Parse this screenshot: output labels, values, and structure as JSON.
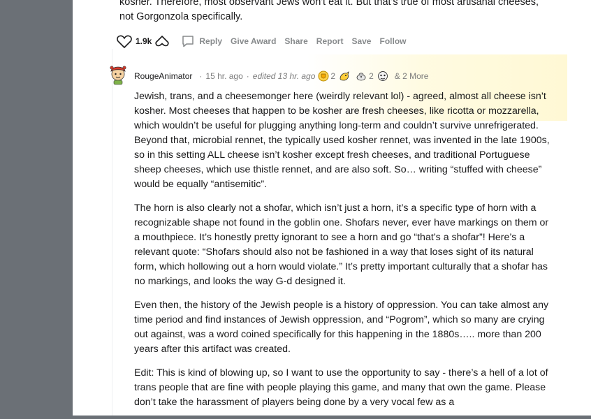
{
  "previous_comment": {
    "text_lines": [
      "kosher. Therefore, most observant Jews won't eat it. But that's true of most artisanal cheeses,",
      "not Gorgonzola specifically."
    ],
    "vote_count": "1.9k",
    "actions": {
      "reply": "Reply",
      "give_award": "Give Award",
      "share": "Share",
      "report": "Report",
      "save": "Save",
      "follow": "Follow"
    }
  },
  "comment": {
    "username": "RougeAnimator",
    "time": "15 hr. ago",
    "edited": "edited 13 hr. ago",
    "awards": [
      {
        "icon": "gold-trophy-icon",
        "count": "2"
      },
      {
        "icon": "helpful-award-icon",
        "count": ""
      },
      {
        "icon": "rocket-award-icon",
        "count": "2"
      },
      {
        "icon": "cheese-award-icon",
        "count": ""
      }
    ],
    "more_awards": "& 2 More",
    "paragraphs": [
      "Jewish, trans, and a cheesemonger here (weirdly relevant lol) - agreed, almost all cheese isn’t kosher. Most cheeses that happen to be kosher are fresh cheeses, like ricotta or mozzarella, which wouldn’t be useful for plugging anything long-term and couldn’t survive unrefrigerated. Beyond that, microbial rennet, the typically used kosher rennet, was invented in the late 1900s, so in this setting ALL cheese isn’t kosher except fresh cheeses, and traditional Portuguese sheep cheeses, which use thistle rennet, and are also soft. So… writing “stuffed with cheese” would be equally “antisemitic”.",
      "The horn is also clearly not a shofar, which isn’t just a horn, it’s a specific type of horn with a recognizable shape not found in the goblin one. Shofars never, ever have markings on them or a mouthpiece. It’s honestly pretty ignorant to see a horn and go “that’s a shofar”! Here’s a relevant quote: “Shofars should also not be fashioned in a way that loses sight of its natural form, which hollowing out a horn would violate.” It’s pretty important culturally that a shofar has no markings, and looks the way G-d designed it.",
      "Even then, the history of the Jewish people is a history of oppression. You can take almost any time period and find instances of Jewish oppression, and “Pogrom”, which so many are crying out against, was a word coined specifically for this happening in the 1880s….. more than 200 years after this artifact was created.",
      "Edit: This is kind of blowing up, so I want to use the opportunity to say - there’s a hell of a lot of trans people that are fine with people playing this game, and many that own the game. Please don’t take the harassment of players being done by a very vocal few as a"
    ]
  },
  "colors": {
    "page_bg": "#6b7076",
    "panel_bg": "#ffffff",
    "text": "#1a1a1b",
    "meta_text": "#7c7c7c",
    "action_text": "#878a8c"
  }
}
